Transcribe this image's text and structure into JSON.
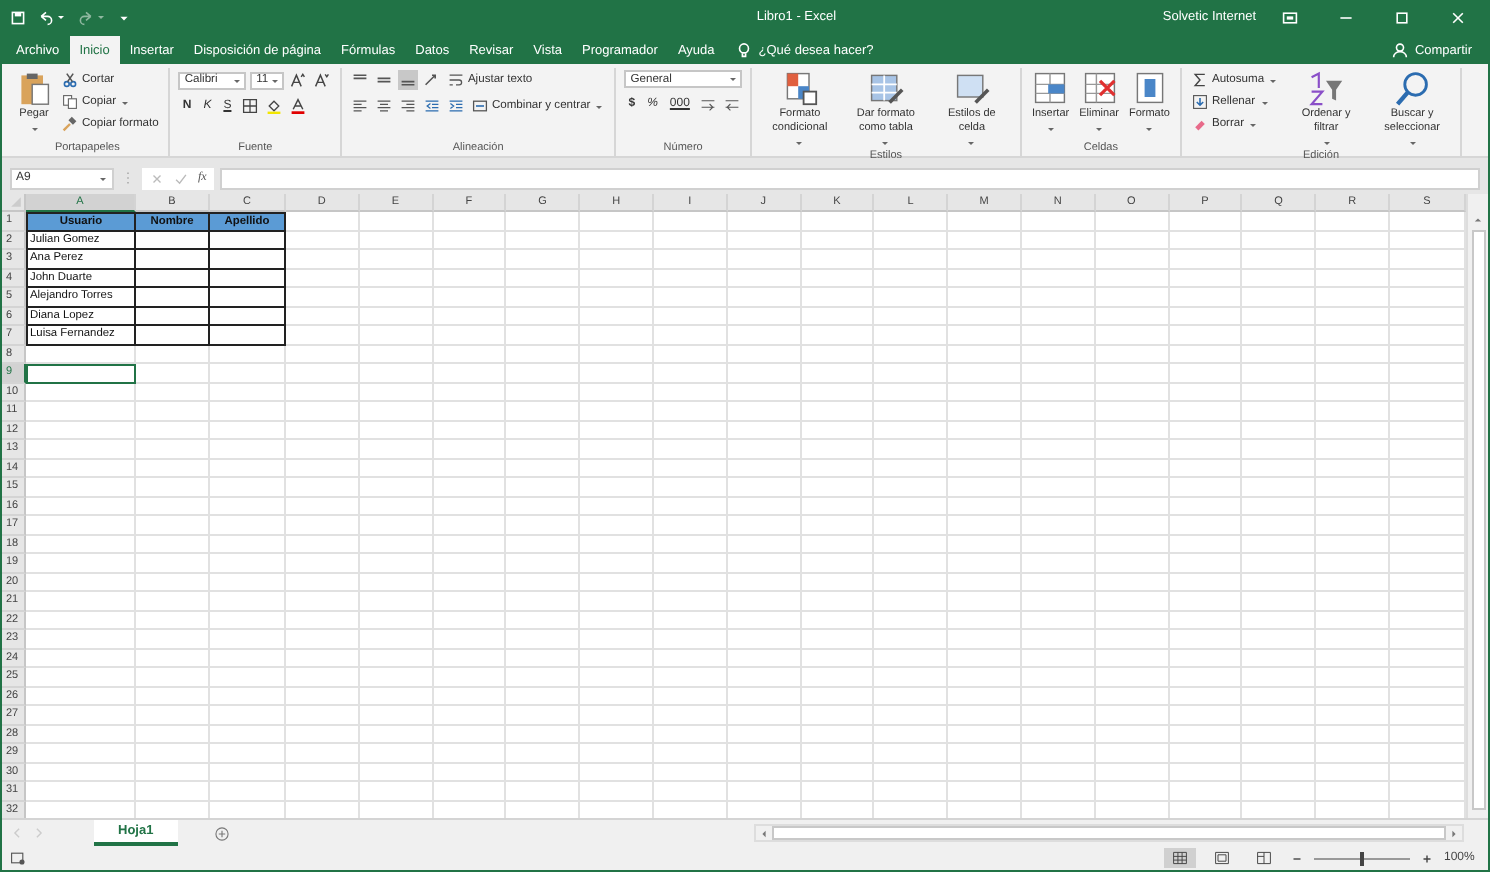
{
  "title_bar": {
    "title": "Libro1 - Excel",
    "user": "Solvetic Internet"
  },
  "menu_tabs": [
    {
      "label": "Archivo",
      "selected": false
    },
    {
      "label": "Inicio",
      "selected": true
    },
    {
      "label": "Insertar",
      "selected": false
    },
    {
      "label": "Disposición de página",
      "selected": false
    },
    {
      "label": "Fórmulas",
      "selected": false
    },
    {
      "label": "Datos",
      "selected": false
    },
    {
      "label": "Revisar",
      "selected": false
    },
    {
      "label": "Vista",
      "selected": false
    },
    {
      "label": "Programador",
      "selected": false
    },
    {
      "label": "Ayuda",
      "selected": false
    }
  ],
  "tell_me": {
    "placeholder": "¿Qué desea hacer?"
  },
  "share": {
    "label": "Compartir"
  },
  "ribbon": {
    "groups": [
      {
        "label": "Portapapeles",
        "kind": "columns",
        "parts": [
          [
            {
              "kind": "large",
              "label": "Pegar",
              "has_menu": true
            }
          ],
          [
            {
              "kind": "small",
              "label": "Cortar",
              "has_menu": false
            },
            {
              "kind": "small",
              "label": "Copiar",
              "has_menu": true
            },
            {
              "kind": "small",
              "label": "Copiar formato",
              "has_menu": false
            }
          ]
        ]
      },
      {
        "label": "Fuente",
        "kind": "rows",
        "parts": [
          [
            {
              "kind": "field",
              "value": "Calibri"
            },
            {
              "kind": "field",
              "value": "11"
            },
            {
              "kind": "icon"
            },
            {
              "kind": "icon"
            }
          ],
          [
            {
              "kind": "letters",
              "letters": [
                "N",
                "K",
                "S"
              ]
            },
            {
              "kind": "icon"
            },
            {
              "kind": "icon"
            },
            {
              "kind": "icon"
            }
          ]
        ]
      },
      {
        "label": "Alineación",
        "kind": "rows",
        "parts": [
          [
            {
              "kind": "icon"
            },
            {
              "kind": "icon"
            },
            {
              "kind": "icon"
            },
            {
              "kind": "icon"
            },
            {
              "kind": "small",
              "label": "Ajustar texto",
              "has_menu": false
            }
          ],
          [
            {
              "kind": "icon"
            },
            {
              "kind": "icon"
            },
            {
              "kind": "icon"
            },
            {
              "kind": "icon"
            },
            {
              "kind": "icon"
            },
            {
              "kind": "small",
              "label": "Combinar y centrar",
              "has_menu": true
            }
          ]
        ]
      },
      {
        "label": "Número",
        "kind": "rows",
        "parts": [
          [
            {
              "kind": "field",
              "value": "General"
            }
          ],
          [
            {
              "kind": "letters",
              "letters": [
                "$",
                "%",
                "000"
              ]
            },
            {
              "kind": "icon"
            },
            {
              "kind": "icon"
            }
          ]
        ]
      },
      {
        "label": "Estilos",
        "kind": "columns",
        "parts": [
          [
            {
              "kind": "large",
              "label": "Formato condicional",
              "has_menu": true
            }
          ],
          [
            {
              "kind": "large",
              "label": "Dar formato como tabla",
              "has_menu": true
            }
          ],
          [
            {
              "kind": "large",
              "label": "Estilos de celda",
              "has_menu": true
            }
          ]
        ]
      },
      {
        "label": "Celdas",
        "kind": "columns",
        "parts": [
          [
            {
              "kind": "large",
              "label": "Insertar",
              "has_menu": true
            }
          ],
          [
            {
              "kind": "large",
              "label": "Eliminar",
              "has_menu": true
            }
          ],
          [
            {
              "kind": "large",
              "label": "Formato",
              "has_menu": true
            }
          ]
        ]
      },
      {
        "label": "Edición",
        "kind": "columns",
        "parts": [
          [
            {
              "kind": "small",
              "label": "Autosuma",
              "has_menu": true
            },
            {
              "kind": "small",
              "label": "Rellenar",
              "has_menu": true
            },
            {
              "kind": "small",
              "label": "Borrar",
              "has_menu": true
            }
          ],
          [
            {
              "kind": "large",
              "label": "Ordenar y filtrar",
              "has_menu": true
            }
          ],
          [
            {
              "kind": "large",
              "label": "Buscar y seleccionar",
              "has_menu": true
            }
          ]
        ]
      }
    ]
  },
  "formula_bar": {
    "name_box": "A9",
    "function_label": "fx"
  },
  "sheet": {
    "columns": [
      {
        "label": "A",
        "selected": true
      },
      {
        "label": "B",
        "selected": false
      },
      {
        "label": "C",
        "selected": false
      },
      {
        "label": "D",
        "selected": false
      },
      {
        "label": "E",
        "selected": false
      },
      {
        "label": "F",
        "selected": false
      },
      {
        "label": "G",
        "selected": false
      },
      {
        "label": "H",
        "selected": false
      },
      {
        "label": "I",
        "selected": false
      },
      {
        "label": "J",
        "selected": false
      },
      {
        "label": "K",
        "selected": false
      },
      {
        "label": "L",
        "selected": false
      },
      {
        "label": "M",
        "selected": false
      },
      {
        "label": "N",
        "selected": false
      },
      {
        "label": "O",
        "selected": false
      },
      {
        "label": "P",
        "selected": false
      },
      {
        "label": "Q",
        "selected": false
      },
      {
        "label": "R",
        "selected": false
      },
      {
        "label": "S",
        "selected": false
      }
    ],
    "rows": [
      {
        "label": "1",
        "selected": false
      },
      {
        "label": "2",
        "selected": false
      },
      {
        "label": "3",
        "selected": false
      },
      {
        "label": "4",
        "selected": false
      },
      {
        "label": "5",
        "selected": false
      },
      {
        "label": "6",
        "selected": false
      },
      {
        "label": "7",
        "selected": false
      },
      {
        "label": "8",
        "selected": false
      },
      {
        "label": "9",
        "selected": true
      },
      {
        "label": "10",
        "selected": false
      },
      {
        "label": "11",
        "selected": false
      },
      {
        "label": "12",
        "selected": false
      },
      {
        "label": "13",
        "selected": false
      },
      {
        "label": "14",
        "selected": false
      },
      {
        "label": "15",
        "selected": false
      },
      {
        "label": "16",
        "selected": false
      },
      {
        "label": "17",
        "selected": false
      },
      {
        "label": "18",
        "selected": false
      },
      {
        "label": "19",
        "selected": false
      },
      {
        "label": "20",
        "selected": false
      },
      {
        "label": "21",
        "selected": false
      },
      {
        "label": "22",
        "selected": false
      },
      {
        "label": "23",
        "selected": false
      },
      {
        "label": "24",
        "selected": false
      },
      {
        "label": "25",
        "selected": false
      },
      {
        "label": "26",
        "selected": false
      },
      {
        "label": "27",
        "selected": false
      },
      {
        "label": "28",
        "selected": false
      },
      {
        "label": "29",
        "selected": false
      },
      {
        "label": "30",
        "selected": false
      },
      {
        "label": "31",
        "selected": false
      },
      {
        "label": "32",
        "selected": false
      }
    ],
    "table": {
      "headers": [
        "Usuario",
        "Nombre",
        "Apellido"
      ],
      "values": [
        "Julian Gomez",
        "Ana Perez",
        "John Duarte",
        "Alejandro Torres",
        "Diana Lopez",
        "Luisa Fernandez"
      ]
    }
  },
  "sheet_tabs": [
    {
      "label": "Hoja1",
      "selected": true
    }
  ],
  "status_bar": {
    "zoom": {
      "level": 0.5,
      "label": "100%"
    }
  }
}
